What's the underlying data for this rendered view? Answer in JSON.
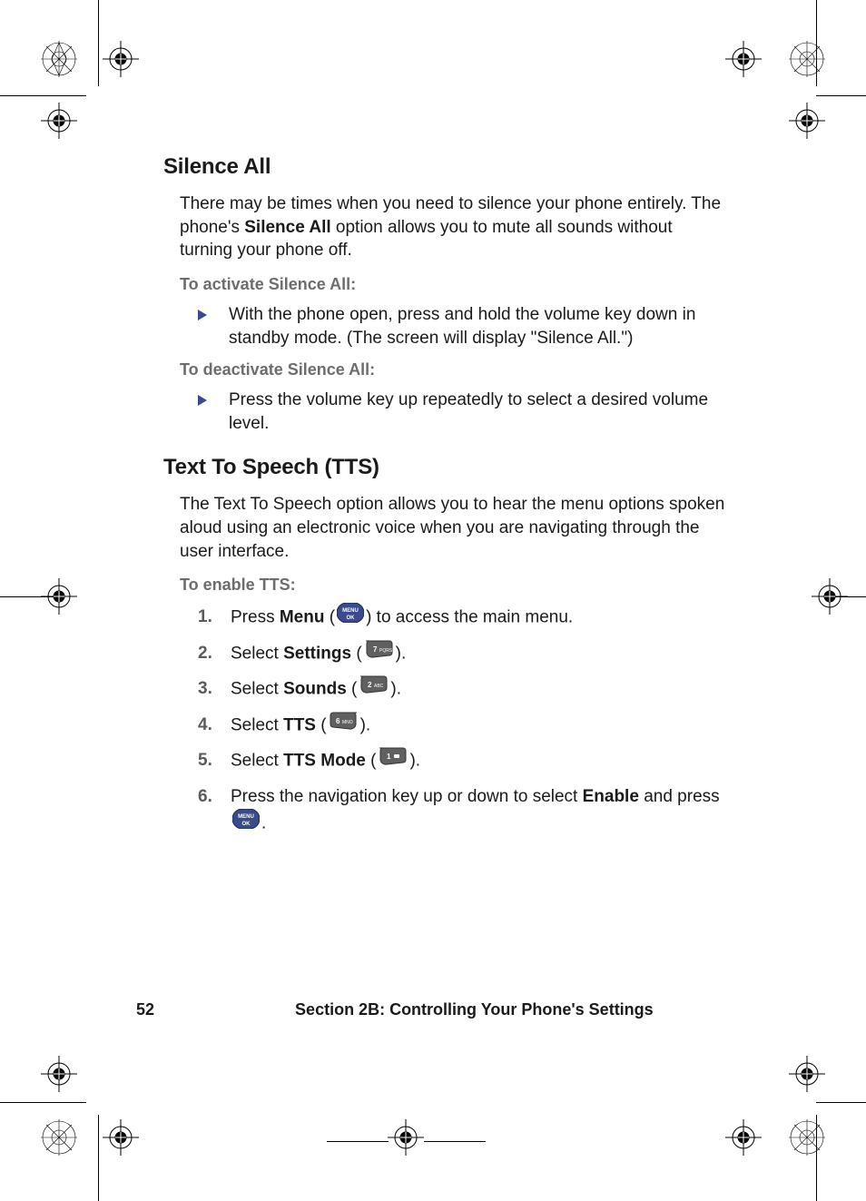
{
  "page_number": "52",
  "footer_section": "Section 2B: Controlling Your Phone's Settings",
  "silence": {
    "heading": "Silence All",
    "intro_pre": "There may be times when you need to silence your phone entirely. The phone's ",
    "intro_bold": "Silence All",
    "intro_post": " option allows you to mute all sounds without turning your phone off.",
    "activate_label": "To activate Silence All:",
    "activate_step": "With the phone open, press and hold the volume key down in standby mode. (The screen will display \"Silence All.\")",
    "deactivate_label": "To deactivate Silence All:",
    "deactivate_step": "Press the volume key up repeatedly to select a desired volume level."
  },
  "tts": {
    "heading": "Text To Speech (TTS)",
    "intro": "The Text To Speech option allows you to hear the menu options spoken aloud using an electronic voice when you are navigating through the user interface.",
    "enable_label": "To enable TTS:",
    "steps": {
      "s1_pre": "Press ",
      "s1_bold": "Menu",
      "s1_post": " to access the main menu.",
      "s2_pre": "Select ",
      "s2_bold": "Settings",
      "s3_pre": "Select ",
      "s3_bold": "Sounds",
      "s4_pre": "Select ",
      "s4_bold": "TTS",
      "s5_pre": "Select ",
      "s5_bold": "TTS Mode",
      "s6_pre": "Press the navigation key up or down to select ",
      "s6_bold": "Enable",
      "s6_mid": " and press ",
      "paren_open": " (",
      "paren_close": ").",
      "period": "."
    }
  }
}
